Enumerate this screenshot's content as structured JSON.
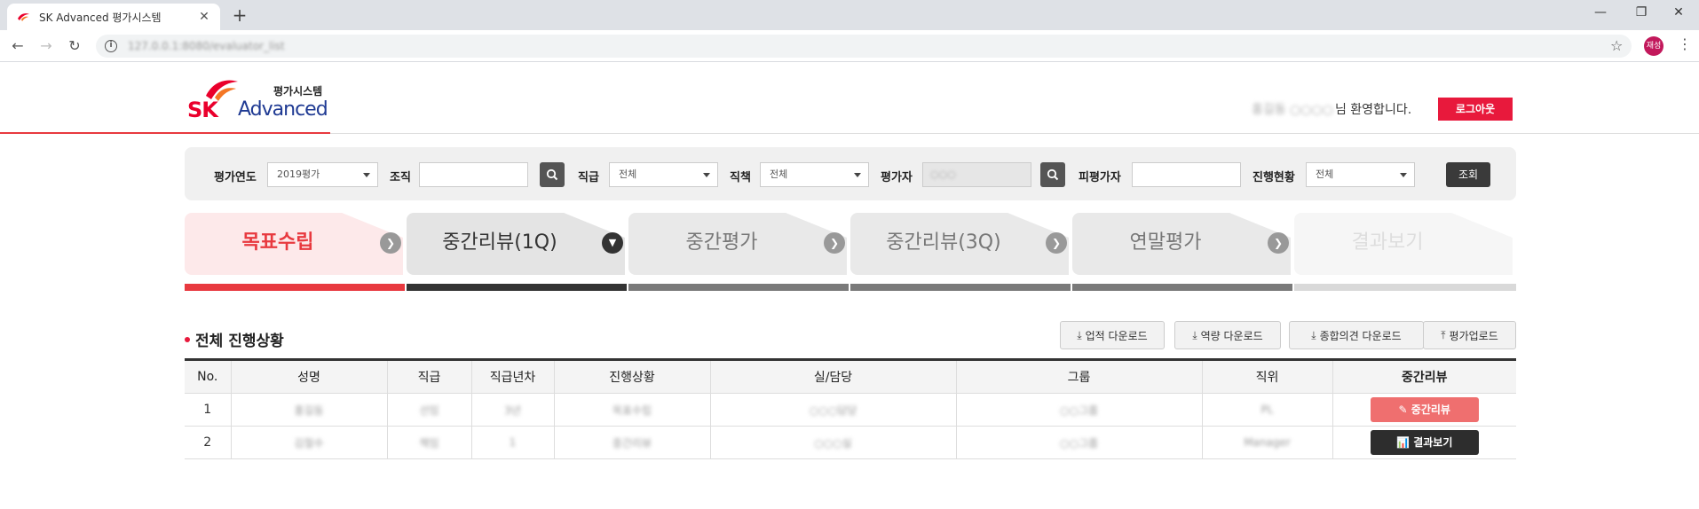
{
  "browser": {
    "tab_title": "SK Advanced 평가시스템",
    "url": "127.0.0.1:8080/evaluator_list",
    "profile_label": "재성"
  },
  "header": {
    "logo_brand": "SK",
    "logo_product": "Advanced",
    "logo_system": "평가시스템",
    "welcome_name": "홍길동 ○○○○",
    "welcome_suffix": "님 환영합니다.",
    "logout_label": "로그아웃"
  },
  "search": {
    "year_label": "평가연도",
    "year_value": "2019평가",
    "org_label": "조직",
    "org_value": "",
    "grade_label": "직급",
    "grade_value": "전체",
    "position_label": "직책",
    "position_value": "전체",
    "evaluator_label": "평가자",
    "evaluator_value": "○○○",
    "evaluatee_label": "피평가자",
    "evaluatee_value": "",
    "status_label": "진행현황",
    "status_value": "전체",
    "query_label": "조회"
  },
  "steps": [
    {
      "label": "목표수립"
    },
    {
      "label": "중간리뷰(1Q)"
    },
    {
      "label": "중간평가"
    },
    {
      "label": "중간리뷰(3Q)"
    },
    {
      "label": "연말평가"
    },
    {
      "label": "결과보기"
    }
  ],
  "section": {
    "title": "전체 진행상황",
    "buttons": [
      "업적 다운로드",
      "역량 다운로드",
      "종합의견 다운로드",
      "평가업로드"
    ]
  },
  "table": {
    "headers": [
      "No.",
      "성명",
      "직급",
      "직급년차",
      "진행상황",
      "실/담당",
      "그룹",
      "직위",
      "중간리뷰"
    ],
    "rows": [
      {
        "no": "1",
        "name": "홍길동",
        "grade": "선임",
        "years": "3년",
        "status": "목표수립",
        "dept": "○○○담당",
        "group": "○○그룹",
        "title": "PL",
        "action": "중간리뷰"
      },
      {
        "no": "2",
        "name": "김철수",
        "grade": "책임",
        "years": "1",
        "status": "중간리뷰",
        "dept": "○○○실",
        "group": "○○그룹",
        "title": "Manager",
        "action": "결과보기"
      }
    ]
  },
  "colors": {
    "accent_red": "#e8193c",
    "step_active_text": "#e8393f",
    "review_button": "#ef6f6f",
    "result_button": "#2d2d2d"
  }
}
